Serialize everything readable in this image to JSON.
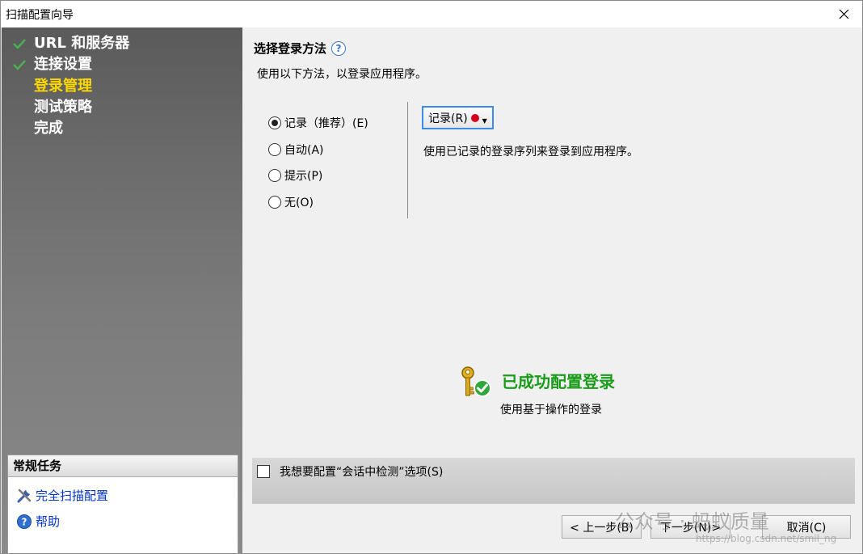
{
  "window": {
    "title": "扫描配置向导"
  },
  "steps": [
    {
      "label": "URL 和服务器",
      "state": "done"
    },
    {
      "label": "连接设置",
      "state": "done"
    },
    {
      "label": "登录管理",
      "state": "current"
    },
    {
      "label": "测试策略",
      "state": "pending"
    },
    {
      "label": "完成",
      "state": "pending"
    }
  ],
  "tasks": {
    "header": "常规任务",
    "items": [
      {
        "label": "完全扫描配置",
        "icon": "tools-icon"
      },
      {
        "label": "帮助",
        "icon": "help-icon"
      }
    ]
  },
  "main": {
    "section_title": "选择登录方法",
    "description": "使用以下方法，以登录应用程序。",
    "login_methods": [
      {
        "label": "记录（推荐）(E)",
        "selected": true
      },
      {
        "label": "自动(A)",
        "selected": false
      },
      {
        "label": "提示(P)",
        "selected": false
      },
      {
        "label": "无(O)",
        "selected": false
      }
    ],
    "record_button": "记录(R)",
    "record_desc": "使用已记录的登录序列来登录到应用程序。",
    "success_title": "已成功配置登录",
    "success_sub": "使用基于操作的登录",
    "session_option": "我想要配置“会话中检测”选项(S)"
  },
  "buttons": {
    "back": "< 上一步(B)",
    "next": "下一步(N)>",
    "cancel": "取消(C)"
  },
  "watermark": {
    "text": "公众号 · 蚂蚁质量",
    "url": "https://blog.csdn.net/smil_ng"
  },
  "colors": {
    "current_step": "#ffd700",
    "success_text": "#1a9b1a",
    "link": "#0033cc",
    "record_dot": "#d9001b"
  }
}
